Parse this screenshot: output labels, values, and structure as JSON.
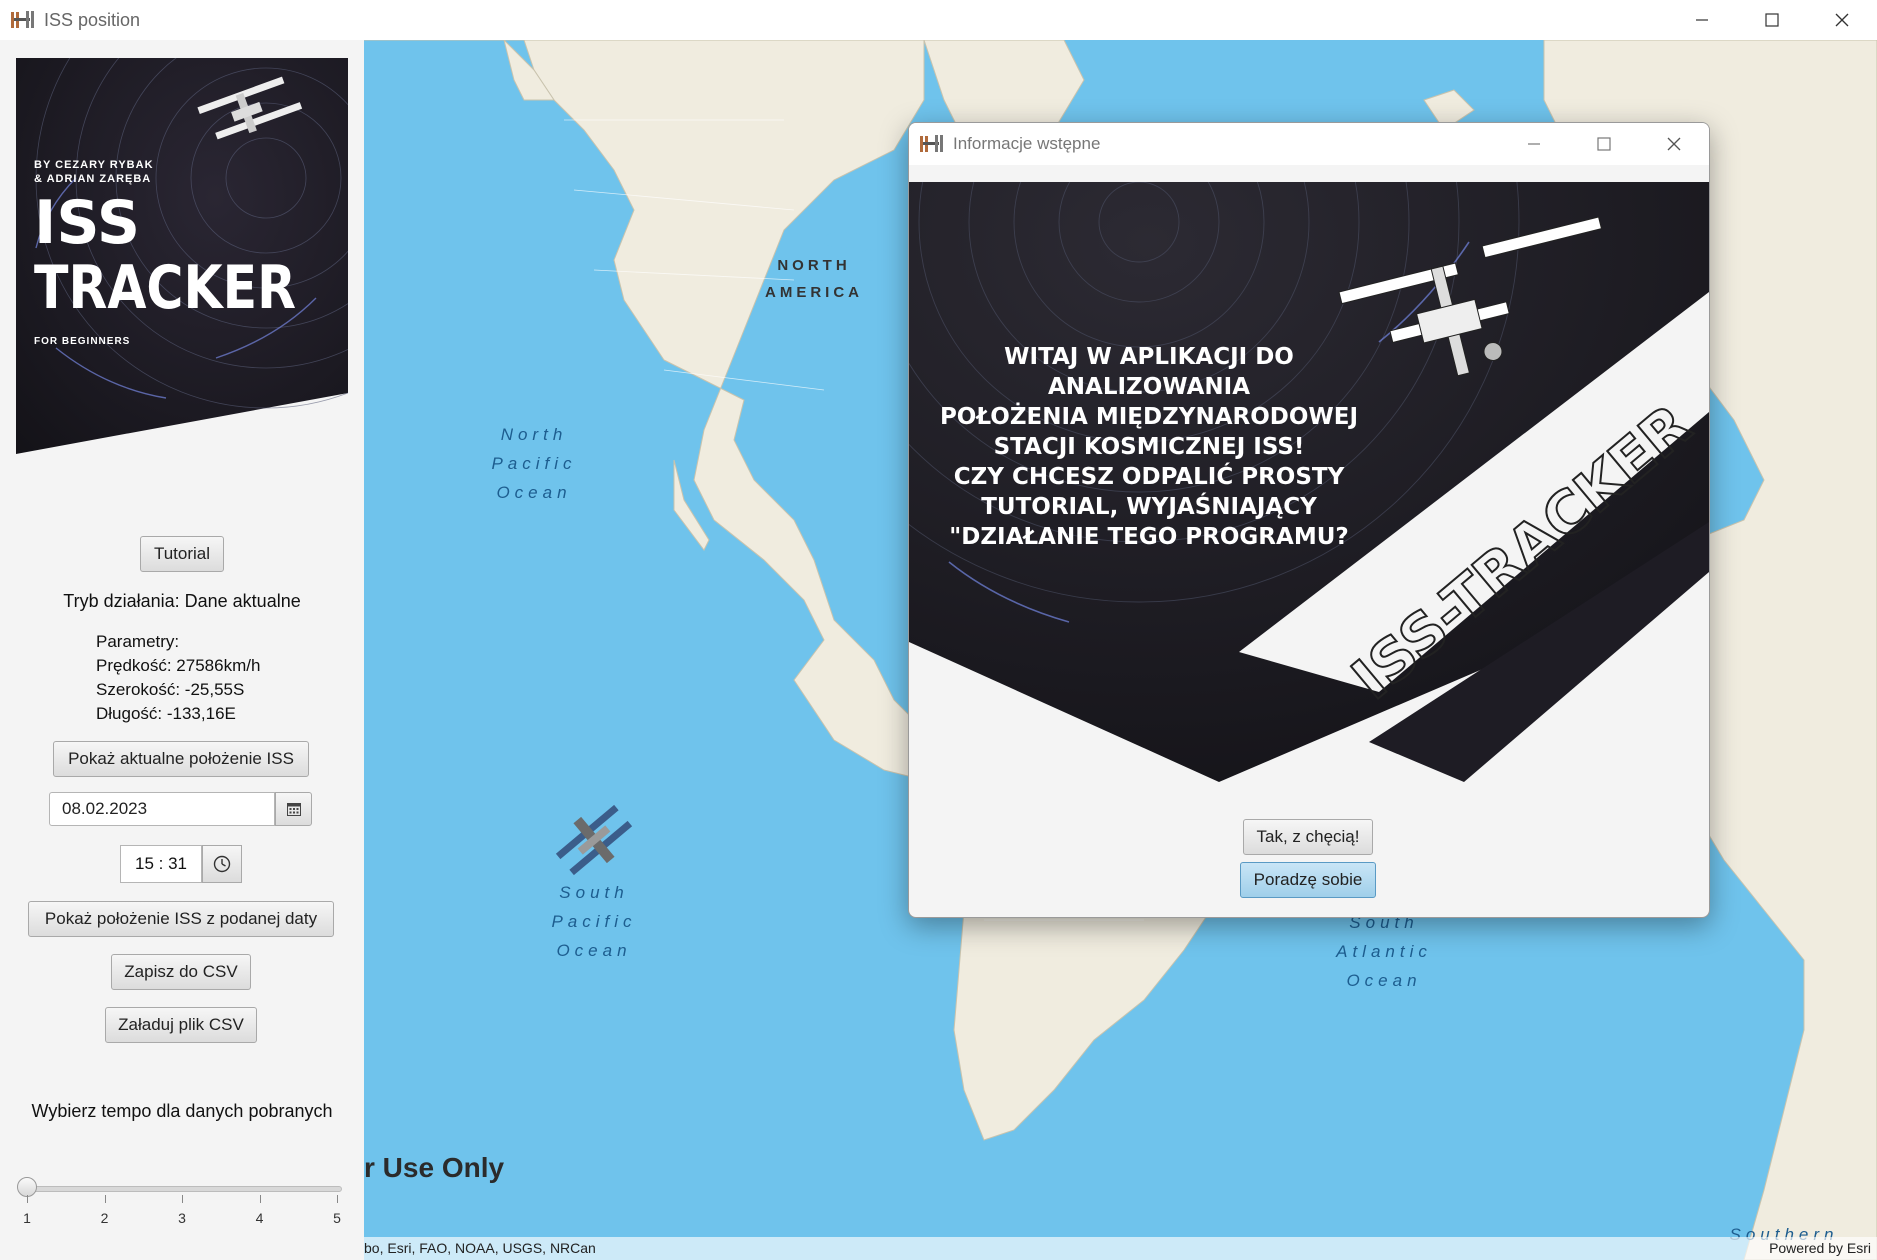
{
  "window": {
    "title": "ISS position"
  },
  "sidebar": {
    "cover": {
      "authors_line1": "BY CEZARY RYBAK",
      "authors_line2": "& ADRIAN ZARĘBA",
      "title_line1": "ISS",
      "title_line2": "TRACKER",
      "subtitle": "FOR BEGINNERS"
    },
    "tutorial_button": "Tutorial",
    "mode_text": "Tryb działania: Dane aktualne",
    "params": {
      "heading": "Parametry:",
      "speed": "Prędkość: 27586km/h",
      "latitude": "Szerokość: -25,55S",
      "longitude": "Długość: -133,16E"
    },
    "show_current_button": "Pokaż aktualne położenie ISS",
    "date_value": "08.02.2023",
    "time_value": "15 : 31",
    "show_date_button": "Pokaż położenie ISS z podanej daty",
    "save_csv_button": "Zapisz do CSV",
    "load_csv_button": "Załaduj plik CSV",
    "speed_label": "Wybierz tempo dla danych pobranych",
    "slider": {
      "ticks": [
        "1",
        "2",
        "3",
        "4",
        "5"
      ],
      "value": 1,
      "min": 1,
      "max": 5
    }
  },
  "map": {
    "labels": {
      "north_america_1": "NORTH",
      "north_america_2": "AMERICA",
      "north_pacific_1": "North",
      "north_pacific_2": "Pacific",
      "north_pacific_3": "Ocean",
      "south_pacific_1": "South",
      "south_pacific_2": "Pacific",
      "south_pacific_3": "Ocean",
      "south_atlantic_1": "South",
      "south_atlantic_2": "Atlantic",
      "south_atlantic_3": "Ocean",
      "southern": "Southern"
    },
    "watermark": "r Use Only",
    "attribution_left": "bo, Esri, FAO, NOAA, USGS, NRCan",
    "attribution_right": "Powered by Esri"
  },
  "dialog": {
    "title": "Informacje wstępne",
    "banner_text": "ISS-TRACKER",
    "welcome_lines": [
      "WITAJ W APLIKACJI DO",
      "ANALIZOWANIA",
      "POŁOŻENIA MIĘDZYNARODOWEJ",
      "STACJI KOSMICZNEJ ISS!",
      "CZY CHCESZ ODPALIĆ PROSTY",
      "TUTORIAL, WYJAŚNIAJĄCY",
      "\"DZIAŁANIE TEGO PROGRAMU?"
    ],
    "yes_button": "Tak, z chęcią!",
    "no_button": "Poradzę sobie"
  }
}
